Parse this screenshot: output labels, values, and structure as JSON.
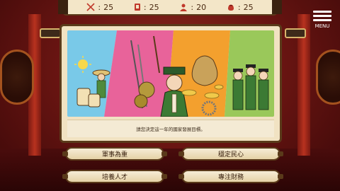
{
  "status": {
    "stats": [
      {
        "icon": "crossed-swords-icon",
        "value": "25"
      },
      {
        "icon": "scroll-icon",
        "value": "25"
      },
      {
        "icon": "person-icon",
        "value": "20"
      },
      {
        "icon": "coin-pouch-icon",
        "value": "25"
      }
    ],
    "separator": ":"
  },
  "menu": {
    "label": "MENU",
    "icon": "hamburger-icon"
  },
  "dialog": {
    "prompt": "請您決定這一年的國家發展目標。",
    "options": [
      "軍事為重",
      "穩定民心",
      "培養人才",
      "專注財務"
    ]
  },
  "colors": {
    "panel_bg": "#f1e2c2",
    "border": "#5a3a1a",
    "stripe_blue": "#79c9e8",
    "stripe_pink": "#e8639a",
    "stripe_orange": "#f3a02e",
    "stripe_green": "#9ac85a"
  }
}
